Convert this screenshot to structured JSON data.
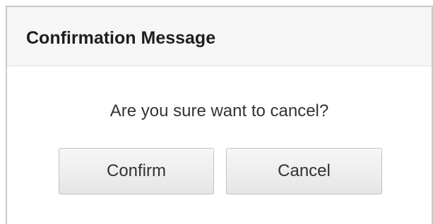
{
  "dialog": {
    "title": "Confirmation Message",
    "message": "Are you sure want to cancel?",
    "confirm_label": "Confirm",
    "cancel_label": "Cancel"
  },
  "colors": {
    "header_background": "#f6f6f6",
    "border": "#c9c9c9",
    "button_background": "#ececec",
    "text": "#333333"
  }
}
